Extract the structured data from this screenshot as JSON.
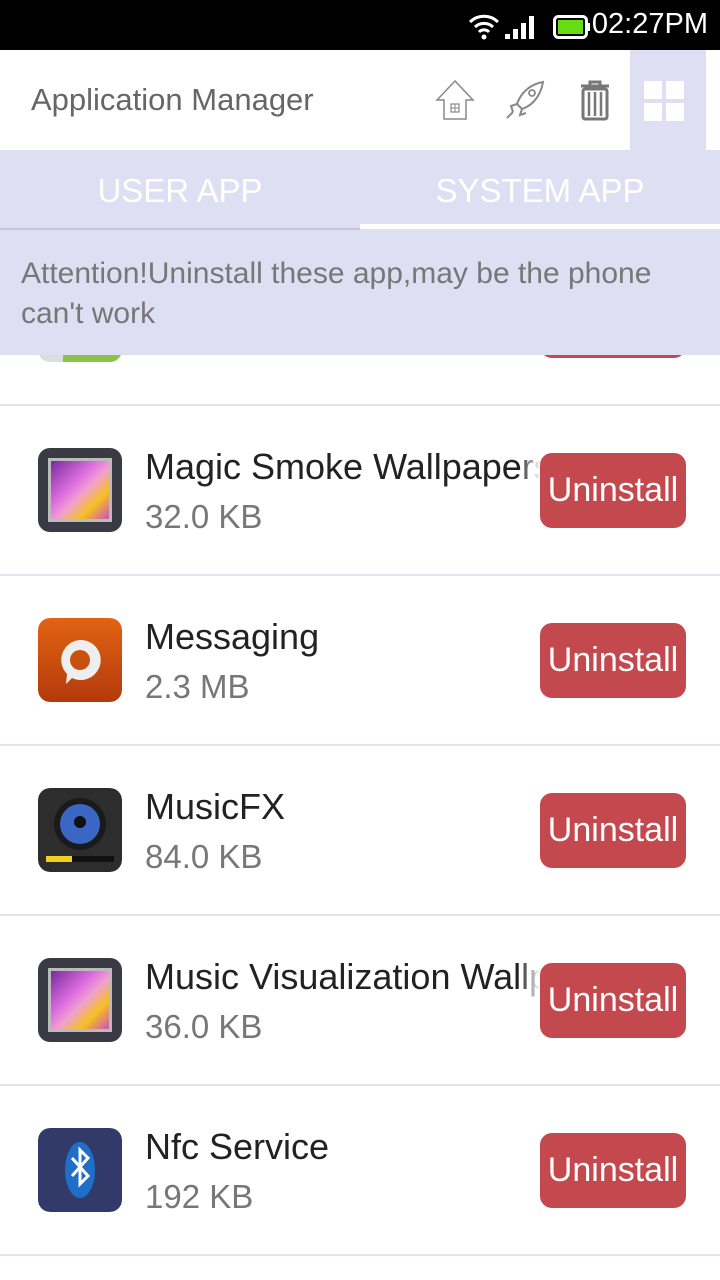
{
  "status_bar": {
    "time": "02:27PM",
    "icons": [
      "wifi-icon",
      "signal-icon",
      "battery-icon"
    ],
    "battery_color": "#66dd11"
  },
  "header": {
    "title": "Application Manager",
    "actions": [
      "home-icon",
      "rocket-icon",
      "trash-icon",
      "grid-icon"
    ]
  },
  "tabs": [
    {
      "label": "USER APP",
      "selected": false
    },
    {
      "label": "SYSTEM APP",
      "selected": true
    }
  ],
  "banner": {
    "text": "Attention!Uninstall these app,may be the phone can't work"
  },
  "accent_color": "#dfdff3",
  "button_color": "#c4494f",
  "apps": [
    {
      "name": "Magic Smoke Wallpapers",
      "size": "32.0 KB",
      "icon": "picture-frame-icon",
      "action": "Uninstall"
    },
    {
      "name": "Messaging",
      "size": "2.3 MB",
      "icon": "messaging-icon",
      "action": "Uninstall"
    },
    {
      "name": "MusicFX",
      "size": "84.0 KB",
      "icon": "speaker-icon",
      "action": "Uninstall"
    },
    {
      "name": "Music Visualization Wallpapers",
      "size": "36.0 KB",
      "icon": "picture-frame-icon",
      "action": "Uninstall"
    },
    {
      "name": "Nfc Service",
      "size": "192 KB",
      "icon": "bluetooth-icon",
      "action": "Uninstall"
    }
  ]
}
